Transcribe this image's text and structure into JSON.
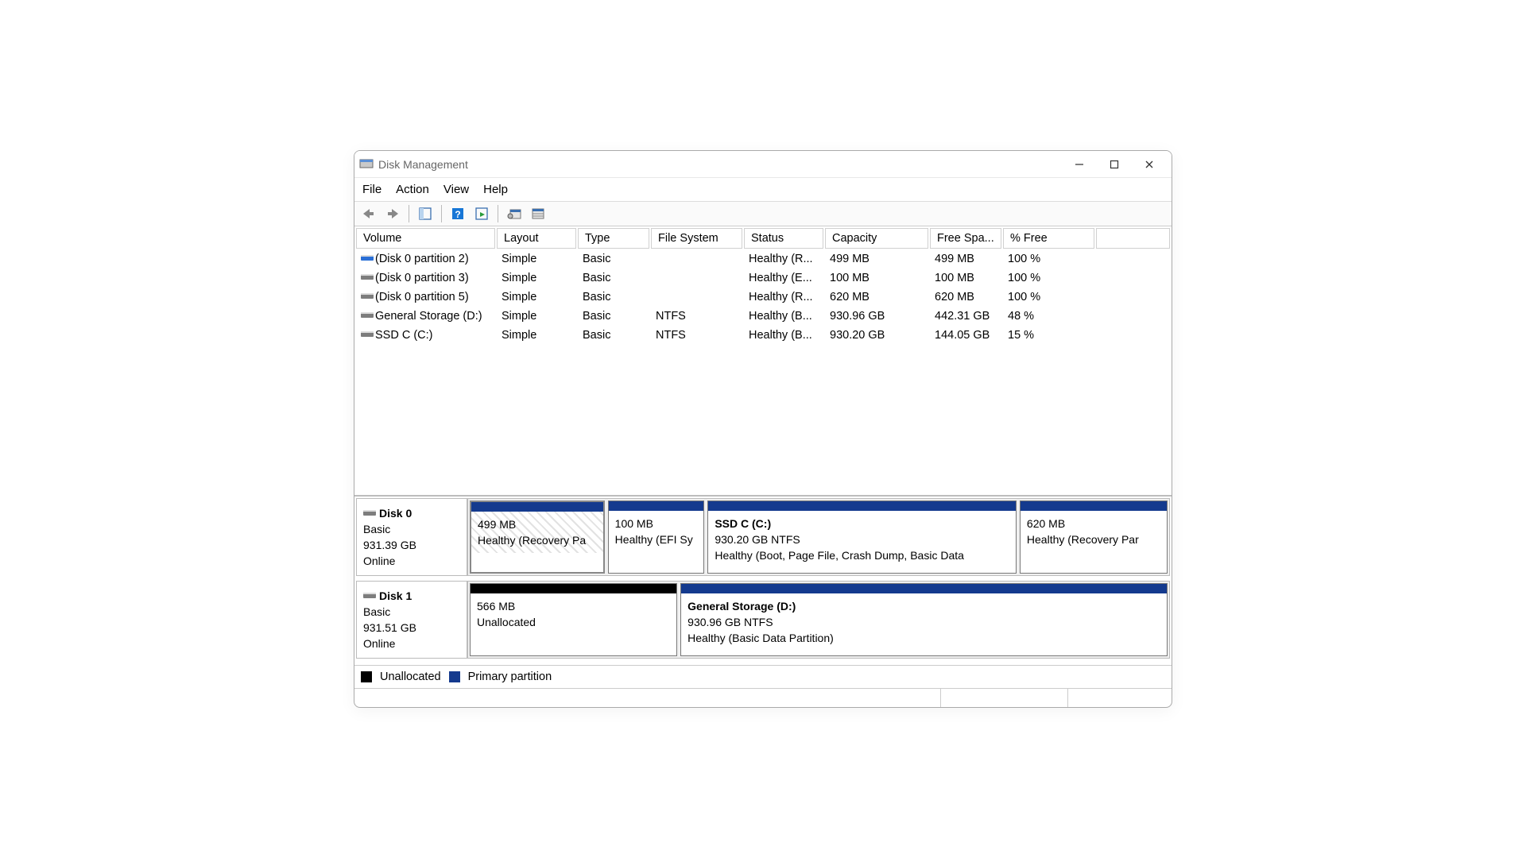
{
  "title": "Disk Management",
  "menu": {
    "file": "File",
    "action": "Action",
    "view": "View",
    "help": "Help"
  },
  "columns": {
    "volume": "Volume",
    "layout": "Layout",
    "type": "Type",
    "filesystem": "File System",
    "status": "Status",
    "capacity": "Capacity",
    "freespace": "Free Spa...",
    "pctfree": "% Free"
  },
  "volumes": [
    {
      "name": "(Disk 0 partition 2)",
      "layout": "Simple",
      "type": "Basic",
      "fs": "",
      "status": "Healthy (R...",
      "capacity": "499 MB",
      "free": "499 MB",
      "pct": "100 %",
      "icon": "blue"
    },
    {
      "name": "(Disk 0 partition 3)",
      "layout": "Simple",
      "type": "Basic",
      "fs": "",
      "status": "Healthy (E...",
      "capacity": "100 MB",
      "free": "100 MB",
      "pct": "100 %",
      "icon": "grey"
    },
    {
      "name": "(Disk 0 partition 5)",
      "layout": "Simple",
      "type": "Basic",
      "fs": "",
      "status": "Healthy (R...",
      "capacity": "620 MB",
      "free": "620 MB",
      "pct": "100 %",
      "icon": "grey"
    },
    {
      "name": "General Storage (D:)",
      "layout": "Simple",
      "type": "Basic",
      "fs": "NTFS",
      "status": "Healthy (B...",
      "capacity": "930.96 GB",
      "free": "442.31 GB",
      "pct": "48 %",
      "icon": "grey"
    },
    {
      "name": "SSD C (C:)",
      "layout": "Simple",
      "type": "Basic",
      "fs": "NTFS",
      "status": "Healthy (B...",
      "capacity": "930.20 GB",
      "free": "144.05 GB",
      "pct": "15 %",
      "icon": "grey"
    }
  ],
  "disks": [
    {
      "name": "Disk 0",
      "type": "Basic",
      "size": "931.39 GB",
      "status": "Online",
      "parts": [
        {
          "title": "",
          "line2": "499 MB",
          "line3": "Healthy (Recovery Pa",
          "stripe": "primary",
          "flex": 18,
          "hatched": true
        },
        {
          "title": "",
          "line2": "100 MB",
          "line3": "Healthy (EFI Sy",
          "stripe": "primary",
          "flex": 13
        },
        {
          "title": "SSD C  (C:)",
          "line2": "930.20 GB NTFS",
          "line3": "Healthy (Boot, Page File, Crash Dump, Basic Data",
          "stripe": "primary",
          "flex": 42
        },
        {
          "title": "",
          "line2": "620 MB",
          "line3": "Healthy (Recovery Par",
          "stripe": "primary",
          "flex": 20
        }
      ]
    },
    {
      "name": "Disk 1",
      "type": "Basic",
      "size": "931.51 GB",
      "status": "Online",
      "parts": [
        {
          "title": "",
          "line2": "566 MB",
          "line3": "Unallocated",
          "stripe": "unalloc",
          "flex": 28
        },
        {
          "title": "General Storage  (D:)",
          "line2": "930.96 GB NTFS",
          "line3": "Healthy (Basic Data Partition)",
          "stripe": "primary",
          "flex": 66
        }
      ]
    }
  ],
  "legend": {
    "unallocated": "Unallocated",
    "primary": "Primary partition"
  }
}
